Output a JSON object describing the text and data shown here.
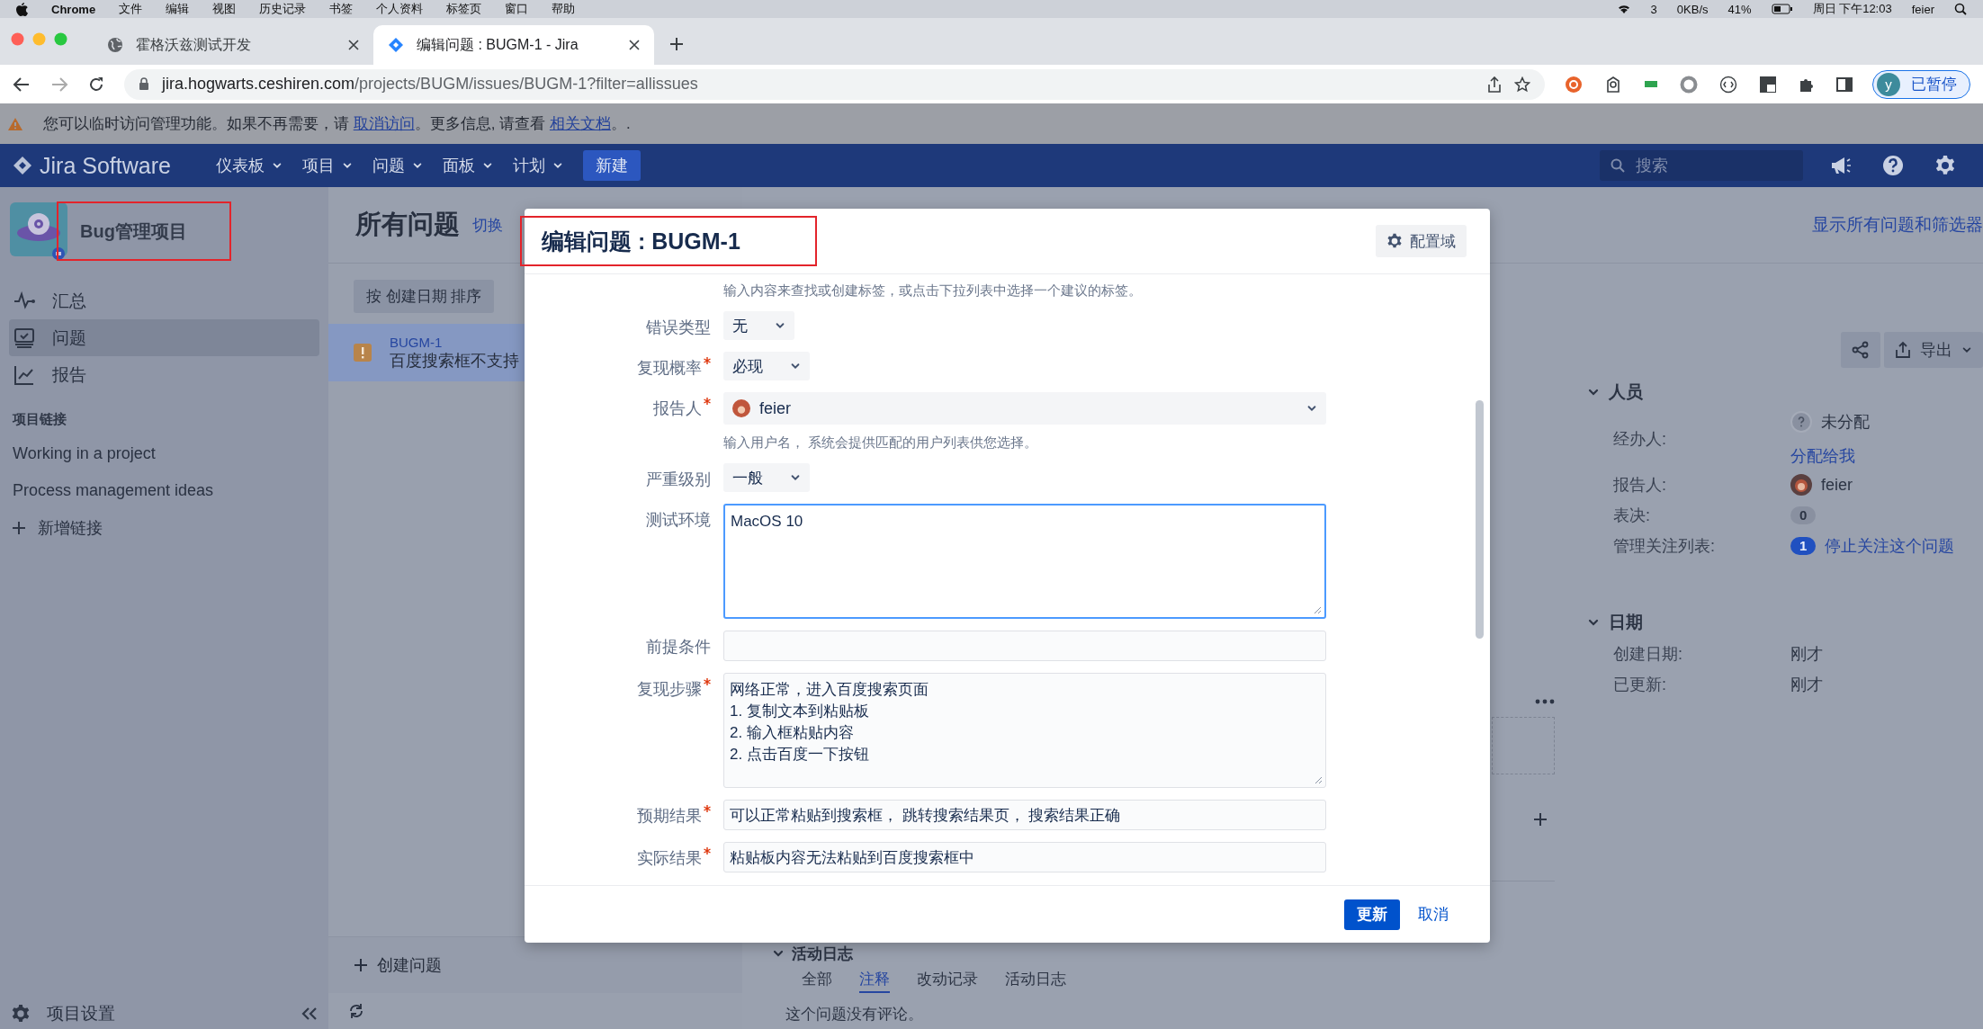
{
  "menubar": {
    "app": "Chrome",
    "items": [
      "文件",
      "编辑",
      "视图",
      "历史记录",
      "书签",
      "个人资料",
      "标签页",
      "窗口",
      "帮助"
    ],
    "status": [
      "3",
      "0KB/s",
      "41%",
      "周日 下午12:03",
      "feier"
    ]
  },
  "browser": {
    "tabs": [
      {
        "title": "霍格沃兹测试开发",
        "selected": false,
        "kind": "globe"
      },
      {
        "title": "编辑问题 : BUGM-1 - Jira",
        "selected": true,
        "kind": "jira"
      }
    ],
    "url_host": "jira.hogwarts.ceshiren.com",
    "url_path": "/projects/BUGM/issues/BUGM-1?filter=allissues",
    "profile": {
      "initial": "y",
      "label": "已暂停"
    }
  },
  "banner": {
    "parts": [
      {
        "text": "您可以临时访问管理功能。如果不再需要，请 ",
        "link": false
      },
      {
        "text": "取消访问",
        "link": true
      },
      {
        "text": "。更多信息, 请查看 ",
        "link": false
      },
      {
        "text": "相关文档",
        "link": true
      },
      {
        "text": "。.",
        "link": false
      }
    ]
  },
  "nav": {
    "logo": "Jira Software",
    "menus": [
      "仪表板",
      "项目",
      "问题",
      "面板",
      "计划"
    ],
    "create": "新建",
    "search_placeholder": "搜索"
  },
  "sidebar": {
    "project": "Bug管理项目",
    "project_annotated": true,
    "items": [
      {
        "label": "汇总",
        "selected": false
      },
      {
        "label": "问题",
        "selected": true
      },
      {
        "label": "报告",
        "selected": false
      }
    ],
    "links_heading": "项目链接",
    "links": [
      "Working in a project",
      "Process management ideas"
    ],
    "add_link": "新增链接",
    "settings": "项目设置"
  },
  "issue_list": {
    "title": "所有问题",
    "switch": "切换",
    "sort": "按 创建日期 排序",
    "issues": [
      {
        "key": "BUGM-1",
        "summary": "百度搜索框不支持",
        "selected": true
      }
    ],
    "create": "创建问题"
  },
  "detail": {
    "all_link": "显示所有问题和筛选器",
    "export": "导出",
    "people": {
      "heading": "人员",
      "expanded": true,
      "rows": [
        {
          "kind": "unassigned",
          "label": "经办人:",
          "value": "未分配",
          "action": "分配给我"
        },
        {
          "kind": "user",
          "label": "报告人:",
          "value": "feier"
        },
        {
          "kind": "count",
          "label": "表决:",
          "value": "0"
        },
        {
          "kind": "watch",
          "label": "管理关注列表:",
          "count": "1",
          "value": "停止关注这个问题"
        }
      ]
    },
    "dates": {
      "heading": "日期",
      "expanded": true,
      "rows": [
        {
          "kind": "text",
          "label": "创建日期:",
          "value": "刚才"
        },
        {
          "kind": "text",
          "label": "已更新:",
          "value": "刚才"
        }
      ]
    },
    "activity": {
      "heading": "活动日志",
      "tabs": [
        {
          "label": "全部",
          "selected": false
        },
        {
          "label": "注释",
          "selected": true
        },
        {
          "label": "改动记录",
          "selected": false
        },
        {
          "label": "活动日志",
          "selected": false
        }
      ],
      "empty": "这个问题没有评论。"
    }
  },
  "dialog": {
    "title": "编辑问题 : BUGM-1",
    "title_annotated": true,
    "config": "配置域",
    "top_hint": "输入内容来查找或创建标签，或点击下拉列表中选择一个建议的标签。",
    "fields": [
      {
        "kind": "select",
        "label": "错误类型",
        "required": false,
        "value": "无"
      },
      {
        "kind": "select",
        "label": "复现概率",
        "required": true,
        "value": "必现"
      },
      {
        "kind": "user",
        "label": "报告人",
        "required": true,
        "value": "feier",
        "hint": "输入用户名， 系统会提供匹配的用户列表供您选择。"
      },
      {
        "kind": "select",
        "label": "严重级别",
        "required": false,
        "value": "一般"
      },
      {
        "kind": "textarea",
        "label": "测试环境",
        "required": false,
        "value": "MacOS 10",
        "focused": true
      },
      {
        "kind": "input",
        "label": "前提条件",
        "required": false,
        "focused": false
      },
      {
        "kind": "textarea",
        "label": "复现步骤",
        "required": true,
        "value": "网络正常，进入百度搜索页面\n1. 复制文本到粘贴板\n2. 输入框粘贴内容\n2. 点击百度一下按钮",
        "focused": false
      },
      {
        "kind": "input",
        "label": "预期结果",
        "required": true,
        "value": "可以正常粘贴到搜索框， 跳转搜索结果页， 搜索结果正确",
        "focused": false
      },
      {
        "kind": "input",
        "label": "实际结果",
        "required": true,
        "value": "粘贴板内容无法粘贴到百度搜索框中",
        "focused": false
      }
    ],
    "submit": "更新",
    "cancel": "取消"
  }
}
